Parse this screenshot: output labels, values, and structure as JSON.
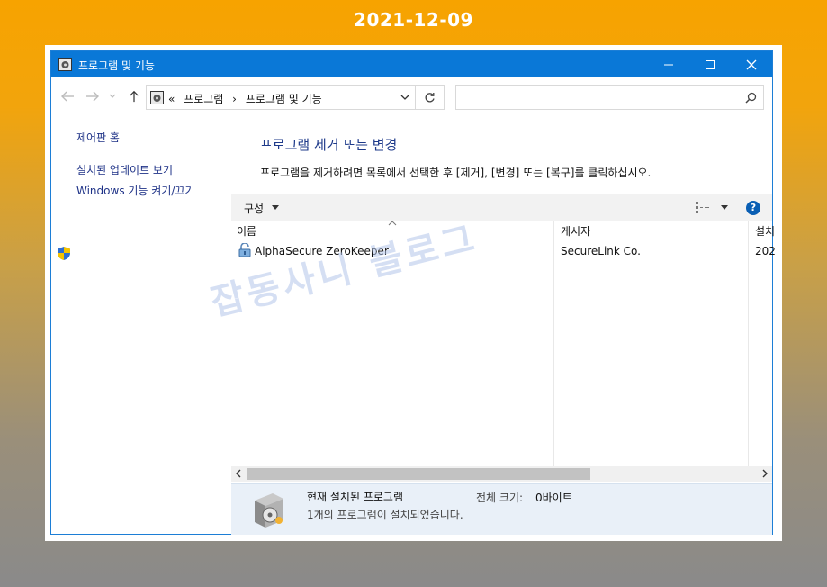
{
  "date": "2021-12-09",
  "window": {
    "title": "프로그램 및 기능",
    "minimize": "minimize",
    "maximize": "maximize",
    "close": "close"
  },
  "address": {
    "overflow": "«",
    "crumbs": [
      "프로그램",
      "›",
      "프로그램 및 기능"
    ]
  },
  "search": {
    "value": "",
    "placeholder": ""
  },
  "left_pane": {
    "items": [
      "제어판 홈",
      "설치된 업데이트 보기",
      "Windows 기능 켜기/끄기"
    ]
  },
  "main": {
    "heading": "프로그램 제거 또는 변경",
    "description": "프로그램을 제거하려면 목록에서 선택한 후 [제거], [변경] 또는 [복구]를 클릭하십시오."
  },
  "command_bar": {
    "organize": "구성",
    "help": "?"
  },
  "columns": [
    "이름",
    "게시자",
    "설치"
  ],
  "rows": [
    {
      "name": "AlphaSecure ZeroKeeper",
      "publisher": "SecureLink Co.",
      "installed": "202"
    }
  ],
  "watermark": "잡동사니 블로그",
  "details": {
    "title": "현재 설치된 프로그램",
    "size_label": "전체 크기:",
    "size_value": "0바이트",
    "count_text": "1개의 프로그램이 설치되었습니다."
  },
  "colors": {
    "titlebar": "#0a78d7",
    "link": "#1e3287",
    "heading": "#1e3a8a",
    "details_bg": "#e9f0f8"
  },
  "icons": {
    "app": "control-panel-icon",
    "back": "arrow-left-icon",
    "forward": "arrow-right-icon",
    "up": "arrow-up-icon",
    "refresh": "refresh-icon",
    "search": "search-icon",
    "shield": "uac-shield-icon",
    "program": "lock-icon",
    "view": "view-list-icon",
    "help": "help-icon"
  }
}
